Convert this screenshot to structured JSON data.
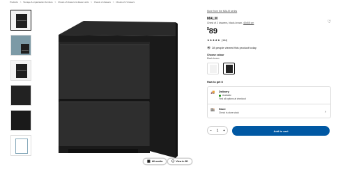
{
  "breadcrumb": [
    "Products",
    ">",
    "Storage & organisation furniture",
    ">",
    "Chests of drawers & drawer units",
    ">",
    "Chests of drawers",
    ">",
    "Chests of 2 drawers"
  ],
  "thumbnails": [
    "chest-front",
    "room-setting",
    "drawer-open",
    "texture-detail",
    "dark-detail",
    "dimension-drawing"
  ],
  "media": {
    "all_media_label": "All media",
    "view_3d_label": "View in 3D"
  },
  "product": {
    "series_link": "More from the MALM series",
    "name": "MALM",
    "description": "Chest of 2 drawers, black-brown,",
    "dimensions": "40x55 cm",
    "price_currency": "$",
    "price_value": "89",
    "rating_stars": "★★★★★",
    "rating_count": "(164)",
    "viewed_text": "28 people viewed this product today",
    "colour_label": "Choose colour",
    "colour_value": "Black-brown"
  },
  "fulfilment": {
    "heading": "How to get it",
    "delivery_label": "Delivery",
    "delivery_status": "Available",
    "delivery_sub": "Find all options at checkout",
    "store_label": "Store",
    "store_sub": "Check in-store stock"
  },
  "purchase": {
    "quantity": "1",
    "minus": "−",
    "plus": "+",
    "add_to_cart": "Add to cart"
  },
  "colors": {
    "accent": "#0058a3",
    "available": "#0a8a00",
    "product_dark": "#1f1f1f"
  }
}
